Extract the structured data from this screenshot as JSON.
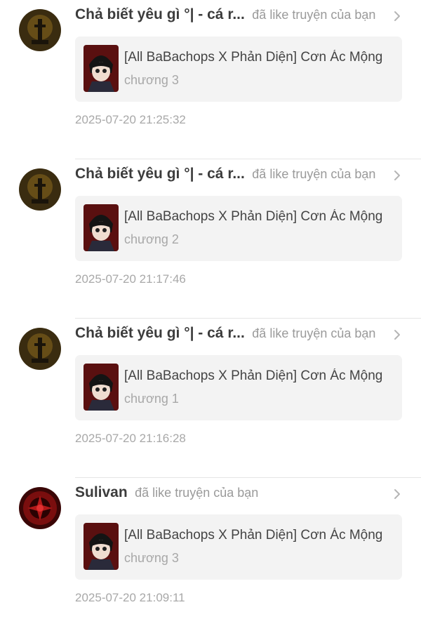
{
  "notifications": [
    {
      "user": "Chả biết yêu gì °| - cá r...",
      "action": "đã like truyện của bạn",
      "avatar_icon": "candle-avatar-icon",
      "story": {
        "title": "[All BaBachops X Phản Diện] Cơn Ác Mộng",
        "chapter": "chương 3"
      },
      "time": "2025-07-20 21:25:32"
    },
    {
      "user": "Chả biết yêu gì °| - cá r...",
      "action": "đã like truyện của bạn",
      "avatar_icon": "candle-avatar-icon",
      "story": {
        "title": "[All BaBachops X Phản Diện] Cơn Ác Mộng",
        "chapter": "chương 2"
      },
      "time": "2025-07-20 21:17:46"
    },
    {
      "user": "Chả biết yêu gì °| - cá r...",
      "action": "đã like truyện của bạn",
      "avatar_icon": "candle-avatar-icon",
      "story": {
        "title": "[All BaBachops X Phản Diện] Cơn Ác Mộng",
        "chapter": "chương 1"
      },
      "time": "2025-07-20 21:16:28"
    },
    {
      "user": "Sulivan",
      "action": "đã like truyện của bạn",
      "avatar_icon": "red-emblem-avatar-icon",
      "story": {
        "title": "[All BaBachops X Phản Diện] Cơn Ác Mộng",
        "chapter": "chương 3"
      },
      "time": "2025-07-20 21:09:11"
    }
  ],
  "colors": {
    "background": "#ffffff",
    "card": "#f3f3f3",
    "username": "#3c3c3c",
    "muted": "#a8a8a8",
    "divider": "#e5e5e5"
  }
}
